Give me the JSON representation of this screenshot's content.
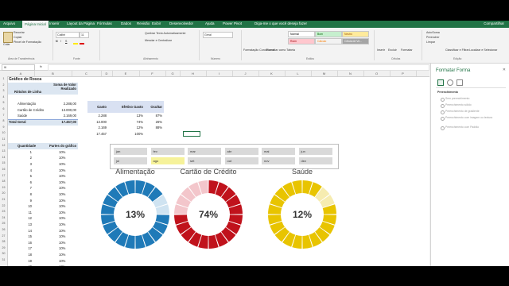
{
  "tabs": [
    "Arquivo",
    "Página Inicial",
    "Inserir",
    "Layout da Página",
    "Fórmulas",
    "Dados",
    "Revisão",
    "Exibir",
    "Desenvolvedor",
    "Ajuda",
    "Power Pivot",
    "Diga-me o que você deseja fazer"
  ],
  "active_tab_index": 1,
  "share_label": "Compartilhar",
  "ribbon": {
    "clipboard": {
      "paste": "Colar",
      "cut": "Recortar",
      "copy": "Copiar",
      "format_painter": "Pincel de Formatação",
      "group": "Área de Transferência"
    },
    "font": {
      "name": "Calibri",
      "size": "11",
      "group": "Fonte"
    },
    "alignment": {
      "wrap": "Quebrar Texto Automaticamente",
      "merge": "Mesclar e Centralizar",
      "group": "Alinhamento"
    },
    "number": {
      "format": "Geral",
      "group": "Número"
    },
    "styles": {
      "conditional": "Formatação Condicional",
      "table": "Formatar como Tabela",
      "normal": "Normal",
      "bom": "Bom",
      "neutro": "Neutro",
      "ruim": "Ruim",
      "calculo": "Cálculo",
      "celula": "Célula de Ve...",
      "group": "Estilos"
    },
    "cells": {
      "insert": "Inserir",
      "delete": "Excluir",
      "format": "Formatar",
      "group": "Células"
    },
    "editing": {
      "autosum": "AutoSoma",
      "fill": "Preencher",
      "clear": "Limpar",
      "sort": "Classificar e Filtrar",
      "find": "Localizar e Selecionar",
      "group": "Edição"
    }
  },
  "formula_bar": {
    "name_box": "I6",
    "fx": "fx"
  },
  "columns": [
    "A",
    "B",
    "C",
    "D",
    "E",
    "F",
    "G",
    "H",
    "I",
    "J",
    "K",
    "L",
    "M",
    "N",
    "O",
    "P"
  ],
  "rows": [
    "1",
    "2",
    "3",
    "4",
    "5",
    "6",
    "7",
    "8",
    "9",
    "10",
    "11",
    "12",
    "13",
    "14",
    "15",
    "16",
    "17",
    "18",
    "19",
    "20",
    "21",
    "22",
    "23",
    "24",
    "25",
    "26",
    "27",
    "28",
    "29",
    "30",
    "31"
  ],
  "sheet": {
    "title": "Gráfico de Rosca",
    "pivot_header": {
      "label": "Rótulos de Linha",
      "sum": "Soma de Valor Realizado"
    },
    "pivot_rows": [
      {
        "label": "Alimentação",
        "value": "2.288,00"
      },
      {
        "label": "Cartão de Crédito",
        "value": "13.000,00"
      },
      {
        "label": "Saúde",
        "value": "2.169,00"
      }
    ],
    "pivot_total": {
      "label": "Total Geral",
      "value": "17.457,00"
    },
    "calc_header": {
      "gasto": "Gasto",
      "excel": "Efetivo Gasto",
      "ocultar": "Ocultar"
    },
    "calc_rows": [
      {
        "gasto": "2.288",
        "efetivo": "13%",
        "ocultar": "87%"
      },
      {
        "gasto": "13.000",
        "efetivo": "74%",
        "ocultar": "26%"
      },
      {
        "gasto": "2.169",
        "efetivo": "12%",
        "ocultar": "88%"
      },
      {
        "gasto": "17.457",
        "efetivo": "100%",
        "ocultar": ""
      }
    ],
    "qty_header": {
      "q": "Quantidade",
      "p": "Partes do gráfico"
    },
    "qty_rows": [
      "1",
      "2",
      "3",
      "4",
      "5",
      "6",
      "7",
      "8",
      "9",
      "10",
      "11",
      "12",
      "13",
      "14",
      "15",
      "16",
      "17",
      "18",
      "19",
      "20"
    ],
    "pct_value": "10%"
  },
  "slicer": {
    "months": [
      "jan",
      "fev",
      "mar",
      "abr",
      "mai",
      "jun",
      "jul",
      "ago",
      "set",
      "out",
      "nov",
      "dez"
    ],
    "selected": "ago"
  },
  "charts": [
    {
      "title": "Alimentação",
      "pct": "13%",
      "filled": 13,
      "color": "#1f7ab8",
      "light": "#cfe3f1"
    },
    {
      "title": "Cartão de Crédito",
      "pct": "74%",
      "filled": 74,
      "color": "#c0121c",
      "light": "#f3c6cb"
    },
    {
      "title": "Saúde",
      "pct": "12%",
      "filled": 12,
      "color": "#e8c400",
      "light": "#f6ecb0"
    }
  ],
  "pane": {
    "title": "Formatar Forma",
    "section": "Preenchimento",
    "options": [
      "Sem preenchimento",
      "Preenchimento sólido",
      "Preenchimento de gradiente",
      "Preenchimento com imagem ou textura",
      "Preenchimento com Padrão"
    ]
  }
}
